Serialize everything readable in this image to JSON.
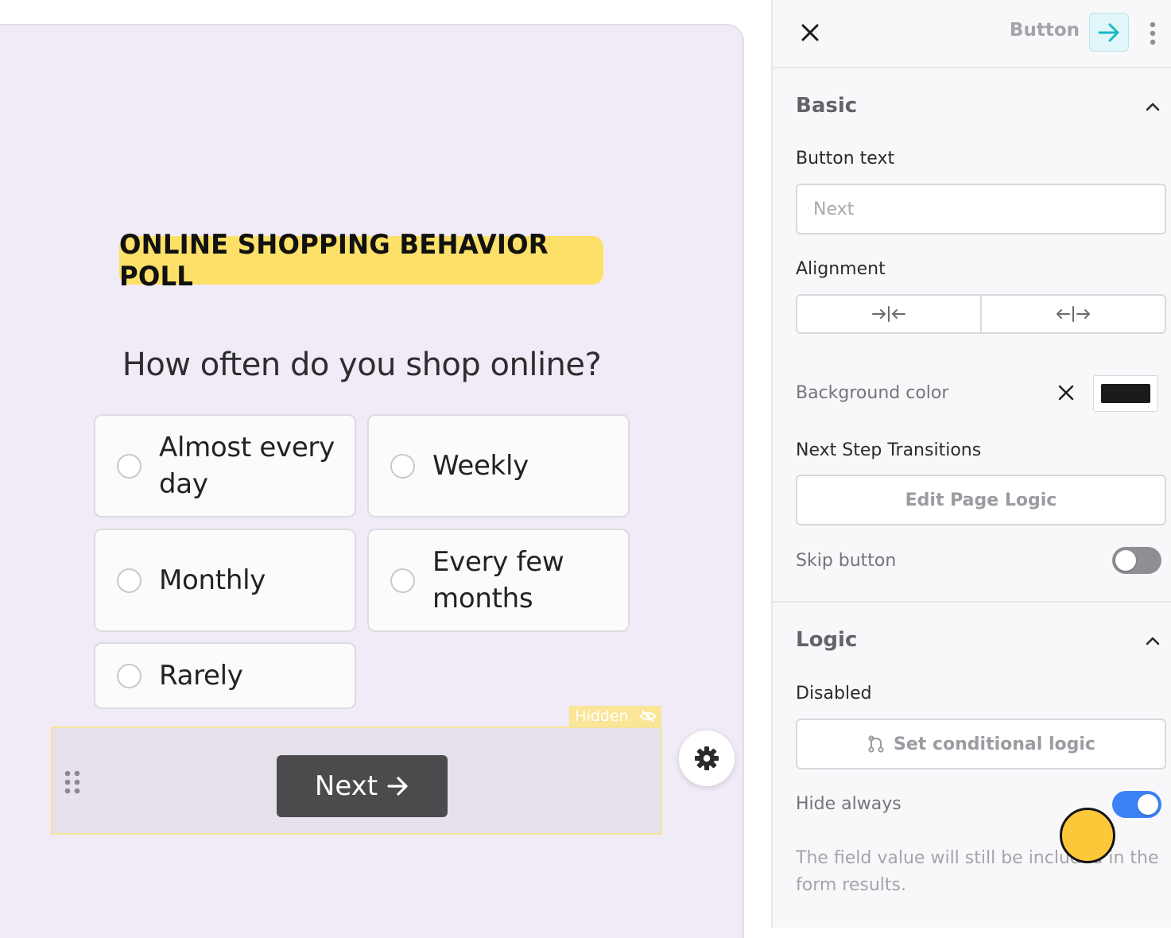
{
  "poll": {
    "title": "ONLINE SHOPPING BEHAVIOR POLL",
    "question": "How often do you shop online?",
    "options": [
      {
        "label": "Almost every day"
      },
      {
        "label": "Weekly"
      },
      {
        "label": "Monthly"
      },
      {
        "label": "Every few months"
      },
      {
        "label": "Rarely"
      }
    ],
    "hidden_tag": "Hidden",
    "next_label": "Next"
  },
  "panel": {
    "header_title": "Button",
    "basic": {
      "title": "Basic",
      "button_text_label": "Button text",
      "button_text_placeholder": "Next",
      "alignment_label": "Alignment",
      "background_color_label": "Background color",
      "background_color": "#1b1b1d",
      "transitions_label": "Next Step Transitions",
      "edit_logic_label": "Edit Page Logic",
      "skip_button_label": "Skip button",
      "skip_button_on": false
    },
    "logic": {
      "title": "Logic",
      "disabled_label": "Disabled",
      "conditional_label": "Set conditional logic",
      "hide_always_label": "Hide always",
      "hide_always_on": true,
      "helper_text": "The field value will still be included in the form results."
    }
  },
  "colors": {
    "canvas_bg": "#f1eaf7",
    "title_highlight": "#fde068",
    "next_button_bg": "#4b4b4d",
    "accent_teal": "#1ab8c9",
    "toggle_on": "#3b82f6",
    "toggle_off": "#8e8e93",
    "cursor": "#fdc73a"
  }
}
